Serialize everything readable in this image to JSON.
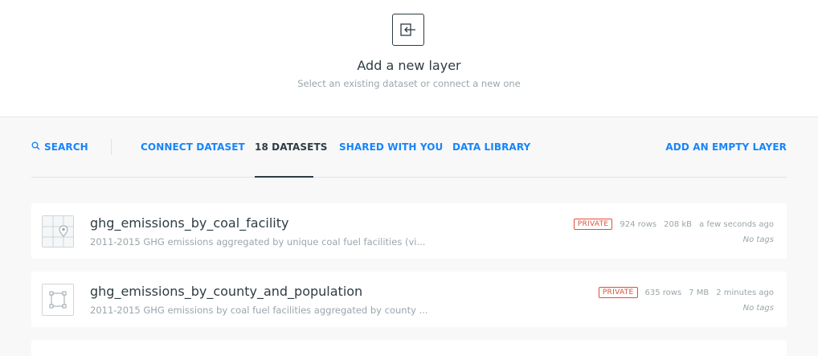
{
  "header": {
    "title": "Add a new layer",
    "subtitle": "Select an existing dataset or connect a new one"
  },
  "tabs": {
    "search": "SEARCH",
    "connect_dataset": "CONNECT DATASET",
    "datasets": "18 DATASETS",
    "shared": "SHARED WITH YOU",
    "library": "DATA LIBRARY",
    "add_empty": "ADD AN EMPTY LAYER"
  },
  "datasets": [
    {
      "name": "ghg_emissions_by_coal_facility",
      "description": "2011-2015 GHG emissions aggregated by unique coal fuel facilities (vi...",
      "privacy": "PRIVATE",
      "rows": "924 rows",
      "size": "208 kB",
      "updated": "a few seconds ago",
      "tags": "No tags",
      "thumb_icon": "map-pin-icon"
    },
    {
      "name": "ghg_emissions_by_county_and_population",
      "description": "2011-2015 GHG emissions by coal fuel facilities aggregated by county ...",
      "privacy": "PRIVATE",
      "rows": "635 rows",
      "size": "7 MB",
      "updated": "2 minutes ago",
      "tags": "No tags",
      "thumb_icon": "polygon-icon"
    }
  ],
  "colors": {
    "accent": "#1785fb",
    "text": "#2e3c43",
    "muted": "#9aa6ab",
    "private": "#e24d39"
  }
}
